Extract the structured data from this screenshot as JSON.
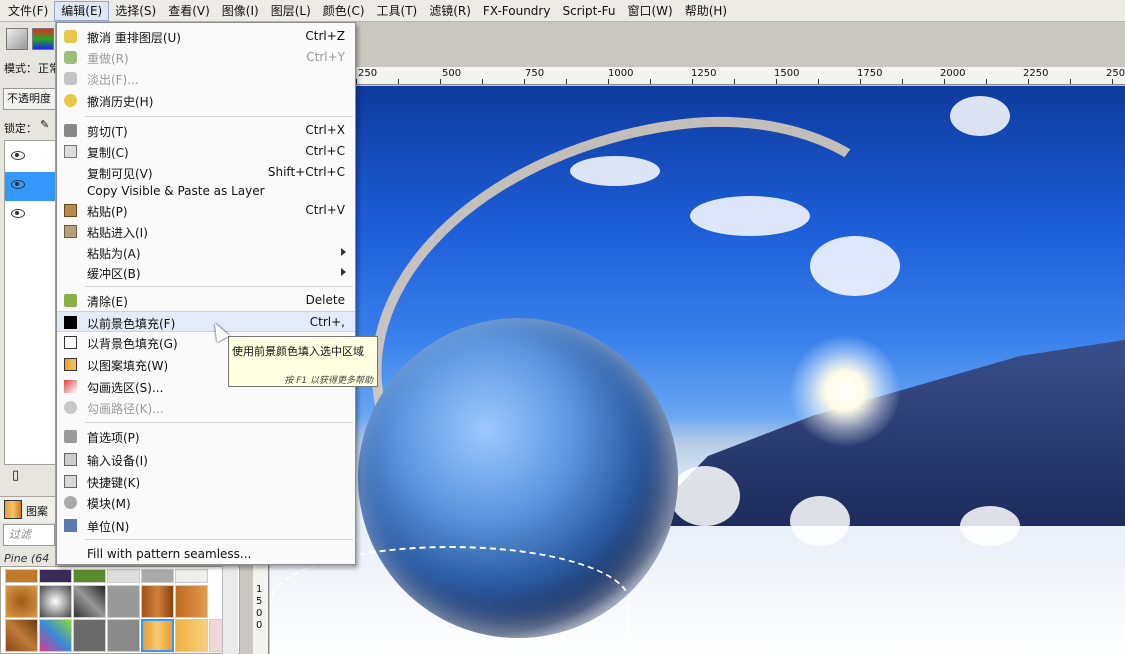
{
  "menubar": {
    "items": [
      {
        "label": "文件(F)"
      },
      {
        "label": "编辑(E)"
      },
      {
        "label": "选择(S)"
      },
      {
        "label": "查看(V)"
      },
      {
        "label": "图像(I)"
      },
      {
        "label": "图层(L)"
      },
      {
        "label": "颜色(C)"
      },
      {
        "label": "工具(T)"
      },
      {
        "label": "滤镜(R)"
      },
      {
        "label": "FX-Foundry"
      },
      {
        "label": "Script-Fu"
      },
      {
        "label": "窗口(W)"
      },
      {
        "label": "帮助(H)"
      }
    ]
  },
  "left_dock": {
    "mode_label": "模式：",
    "mode_value": "正常",
    "opacity_label": "不透明度",
    "lock_label": "锁定：",
    "pattern_tab_label": "图案",
    "filter_placeholder": "过滤",
    "pattern_name": "Pine (64 x"
  },
  "ruler": {
    "top_labels": [
      "250",
      "500",
      "750",
      "1000",
      "1250",
      "1500",
      "1750",
      "2000",
      "2250",
      "250"
    ],
    "left_labels": [
      "1",
      "5",
      "0",
      "0"
    ]
  },
  "edit_menu": {
    "items": [
      {
        "label": "撤消 重排图层(U)",
        "accel": "Ctrl+Z",
        "icon": "undo-icon"
      },
      {
        "label": "重做(R)",
        "accel": "Ctrl+Y",
        "icon": "redo-icon"
      },
      {
        "label": "淡出(F)...",
        "accel": "",
        "icon": "fade-icon"
      },
      {
        "label": "撤消历史(H)",
        "accel": "",
        "icon": "undo-history-icon"
      },
      {
        "label": "剪切(T)",
        "accel": "Ctrl+X",
        "icon": "cut-icon"
      },
      {
        "label": "复制(C)",
        "accel": "Ctrl+C",
        "icon": "copy-icon"
      },
      {
        "label": "复制可见(V)",
        "accel": "Shift+Ctrl+C",
        "icon": ""
      },
      {
        "label": "Copy Visible & Paste as Layer",
        "accel": "",
        "icon": ""
      },
      {
        "label": "粘贴(P)",
        "accel": "Ctrl+V",
        "icon": "paste-icon"
      },
      {
        "label": "粘贴进入(I)",
        "accel": "",
        "icon": "paste-into-icon"
      },
      {
        "label": "粘贴为(A)",
        "accel": "",
        "icon": ""
      },
      {
        "label": "缓冲区(B)",
        "accel": "",
        "icon": ""
      },
      {
        "label": "清除(E)",
        "accel": "Delete",
        "icon": "clear-icon"
      },
      {
        "label": "以前景色填充(F)",
        "accel": "Ctrl+,",
        "icon": "fg-fill-icon"
      },
      {
        "label": "以背景色填充(G)",
        "accel": "",
        "icon": "bg-fill-icon"
      },
      {
        "label": "以图案填充(W)",
        "accel": "",
        "icon": "pattern-fill-icon"
      },
      {
        "label": "勾画选区(S)...",
        "accel": "",
        "icon": "stroke-selection-icon"
      },
      {
        "label": "勾画路径(K)...",
        "accel": "",
        "icon": "stroke-path-icon"
      },
      {
        "label": "首选项(P)",
        "accel": "",
        "icon": "preferences-icon"
      },
      {
        "label": "输入设备(I)",
        "accel": "",
        "icon": "input-devices-icon"
      },
      {
        "label": "快捷键(K)",
        "accel": "",
        "icon": "keyboard-shortcuts-icon"
      },
      {
        "label": "模块(M)",
        "accel": "",
        "icon": "modules-icon"
      },
      {
        "label": "单位(N)",
        "accel": "",
        "icon": "units-icon"
      },
      {
        "label": "Fill with pattern seamless...",
        "accel": "",
        "icon": ""
      }
    ]
  },
  "tooltip": {
    "text": "使用前景颜色填入选中区域",
    "help": "按 F1 以获得更多帮助"
  },
  "colors": {
    "menu_highlight": "#e2ebf7",
    "selection_blue": "#3399ff",
    "tooltip_bg": "#ffffe1"
  }
}
